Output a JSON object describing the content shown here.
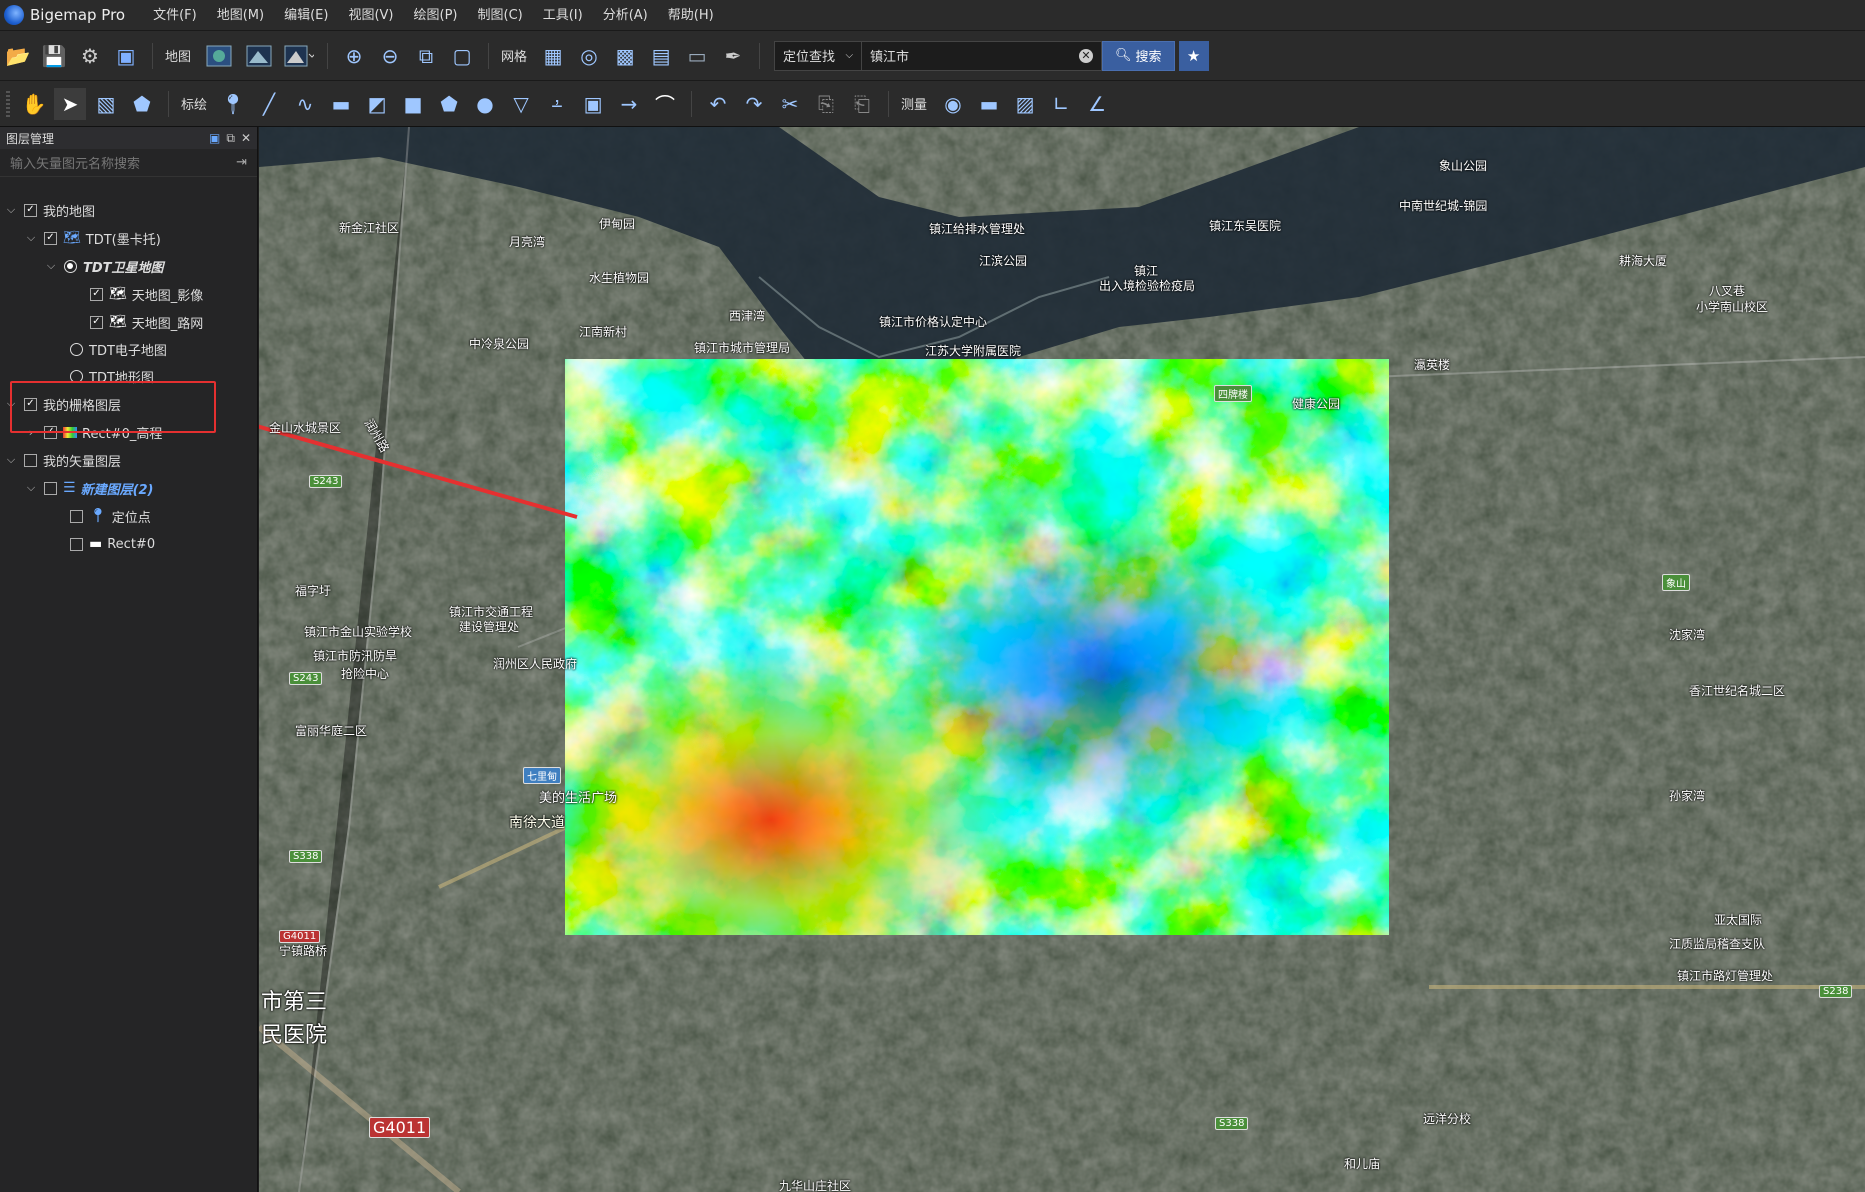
{
  "app": {
    "title": "Bigemap Pro"
  },
  "menu": [
    "文件(F)",
    "地图(M)",
    "编辑(E)",
    "视图(V)",
    "绘图(P)",
    "制图(C)",
    "工具(I)",
    "分析(A)",
    "帮助(H)"
  ],
  "toolbar1": {
    "map_label": "地图",
    "grid_label": "网格",
    "locate_select": "定位查找",
    "search_value": "镇江市",
    "search_button": "搜索"
  },
  "toolbar2": {
    "annotate_label": "标绘",
    "measure_label": "测量"
  },
  "panel": {
    "title": "图层管理",
    "search_placeholder": "输入矢量图元名称搜索",
    "tree": [
      {
        "label": "我的地图",
        "checked": true
      },
      {
        "label": "TDT(墨卡托)",
        "checked": true
      },
      {
        "label": "TDT卫星地图",
        "selected": true
      },
      {
        "label": "天地图_影像",
        "checked": true
      },
      {
        "label": "天地图_路网",
        "checked": true
      },
      {
        "label": "TDT电子地图"
      },
      {
        "label": "TDT地形图"
      },
      {
        "label": "我的栅格图层",
        "checked": true
      },
      {
        "label": "Rect#0_高程",
        "checked": true
      },
      {
        "label": "我的矢量图层",
        "checked": false
      },
      {
        "label": "新建图层(2)",
        "checked": false
      },
      {
        "label": "定位点",
        "checked": false
      },
      {
        "label": "Rect#0",
        "checked": false
      }
    ]
  },
  "map_labels": [
    "新金江社区",
    "伊甸园",
    "月亮湾",
    "水生植物园",
    "镇江东吴医院",
    "镇江给排水管理处",
    "江滨公园",
    "镇江",
    "出入境检验检疫局",
    "镇江市价格认定中心",
    "江苏大学附属医院",
    "镇江市城市管理局",
    "中冷泉公园",
    "西津湾",
    "江南新村",
    "金山水城景区",
    "润州路",
    "福字圩",
    "镇江市金山实验学校",
    "镇江市防汛防旱",
    "抢险中心",
    "镇江市交通工程",
    "建设管理处",
    "润州区人民政府",
    "富丽华庭二区",
    "美的生活广场",
    "南徐大道",
    "宁镇路桥",
    "市第三",
    "民医院",
    "九华山庄社区",
    "远洋分校",
    "和儿庙",
    "象山公园",
    "中南世纪城-锦园",
    "耕海大厦",
    "八叉巷",
    "小学南山校区",
    "瀛英楼",
    "四牌楼",
    "健康公园",
    "象山",
    "香江世纪名城二区",
    "江质监局稽查支队",
    "镇江市路灯管理处",
    "亚太国际",
    "孙家湾",
    "沈家湾"
  ],
  "road_labels": [
    "S243",
    "S243",
    "S338",
    "G4011",
    "G4011",
    "七里甸",
    "S338",
    "S238"
  ],
  "colors": {
    "accent": "#3a5fa0",
    "highlight": "#e53030"
  }
}
